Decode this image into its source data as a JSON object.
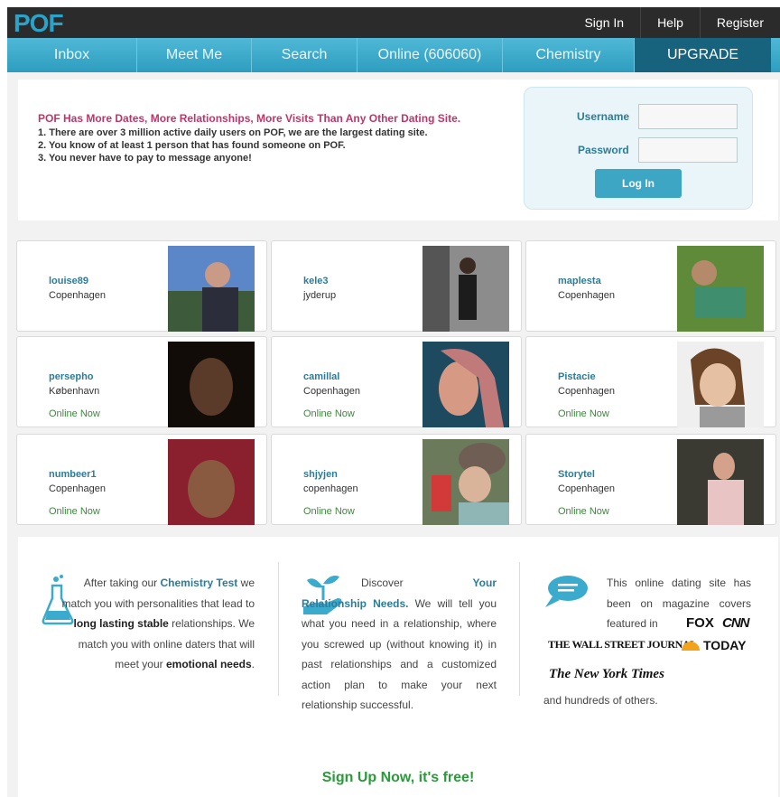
{
  "header": {
    "logo": "POF",
    "sign_in": "Sign In",
    "help": "Help",
    "register": "Register"
  },
  "nav": {
    "inbox": "Inbox",
    "meet_me": "Meet Me",
    "search": "Search",
    "online": "Online (606060)",
    "chemistry": "Chemistry",
    "upgrade": "UPGRADE"
  },
  "intro": {
    "title": "POF Has More Dates, More Relationships, More Visits Than Any Other Dating Site.",
    "points": [
      "1.  There are over 3 million active daily users on POF, we are the largest dating site.",
      "2.  You know of at least 1 person that has found someone on POF.",
      "3.  You never have to pay to message anyone!"
    ]
  },
  "login": {
    "username_label": "Username",
    "password_label": "Password",
    "button": "Log In"
  },
  "profiles": [
    {
      "name": "louise89",
      "city": "Copenhagen",
      "status": ""
    },
    {
      "name": "kele3",
      "city": "jyderup",
      "status": ""
    },
    {
      "name": "maplesta",
      "city": "Copenhagen",
      "status": ""
    },
    {
      "name": "persepho",
      "city": "København",
      "status": "Online Now"
    },
    {
      "name": "camillal",
      "city": "Copenhagen",
      "status": "Online Now"
    },
    {
      "name": "Pistacie",
      "city": "Copenhagen",
      "status": "Online Now"
    },
    {
      "name": "numbeer1",
      "city": "Copenhagen",
      "status": "Online Now"
    },
    {
      "name": "shjyjen",
      "city": "copenhagen",
      "status": "Online Now"
    },
    {
      "name": "Storytel",
      "city": "Copenhagen",
      "status": "Online Now"
    }
  ],
  "features": {
    "f1": {
      "pre": "After taking our ",
      "hl": "Chemistry Test",
      "mid": " we match you with personalities that lead to ",
      "bold1": "long lasting stable",
      "mid2": " relationships. We match you with online daters that will meet your ",
      "bold2": "emotional needs",
      "post": "."
    },
    "f2": {
      "pre": "Discover ",
      "hl": "Your Relationship Needs.",
      "post": " We will tell you what you need in a relationship, where you screwed up (without knowing it) in past relationships and a customized action plan to make your next relationship successful."
    },
    "f3": {
      "text": "This online dating site has been on magazine covers featured in",
      "fox": "FOX",
      "cnn": "CNN",
      "wsj": "THE WALL STREET JOURNAL.",
      "today": "TODAY",
      "nyt": "The New York Times",
      "tail": "and hundreds of others."
    },
    "signup": "Sign Up Now, it's free!"
  },
  "colors": {
    "nav_blue": "#3aabcc",
    "upgrade": "#17627c",
    "title_pink": "#c0346a",
    "online_green": "#3a8a3a",
    "signup_green": "#2a9a3a"
  }
}
